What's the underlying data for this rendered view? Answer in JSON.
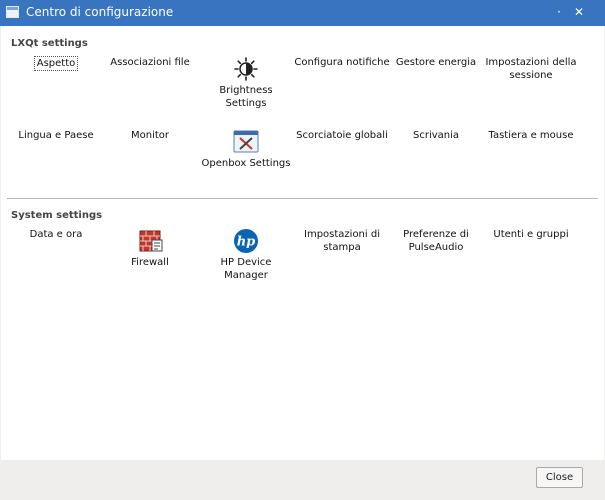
{
  "window": {
    "title": "Centro di configurazione",
    "controls": [
      "·",
      "✕"
    ]
  },
  "sections": [
    {
      "label": "LXQt settings",
      "items": [
        {
          "label": "Aspetto",
          "icon": null
        },
        {
          "label": "Associazioni file",
          "icon": null
        },
        {
          "label": "Brightness Settings",
          "icon": "brightness-icon"
        },
        {
          "label": "Configura notifiche",
          "icon": null
        },
        {
          "label": "Gestore energia",
          "icon": null
        },
        {
          "label": "Impostazioni della\nsessione",
          "icon": null
        },
        {
          "label": "Lingua e Paese",
          "icon": null
        },
        {
          "label": "Monitor",
          "icon": null
        },
        {
          "label": "Openbox Settings",
          "icon": "openbox-icon"
        },
        {
          "label": "Scorciatoie globali",
          "icon": null
        },
        {
          "label": "Scrivania",
          "icon": null
        },
        {
          "label": "Tastiera e mouse",
          "icon": null
        }
      ]
    },
    {
      "label": "System settings",
      "items": [
        {
          "label": "Data e ora",
          "icon": null
        },
        {
          "label": "Firewall",
          "icon": "firewall-icon"
        },
        {
          "label": "HP Device\nManager",
          "icon": "hp-logo-icon"
        },
        {
          "label": "Impostazioni di\nstampa",
          "icon": null
        },
        {
          "label": "Preferenze di\nPulseAudio",
          "icon": null
        },
        {
          "label": "Utenti e gruppi",
          "icon": null
        }
      ]
    }
  ],
  "footer": {
    "close_label": "Close"
  },
  "hp_logo_text": "hp"
}
